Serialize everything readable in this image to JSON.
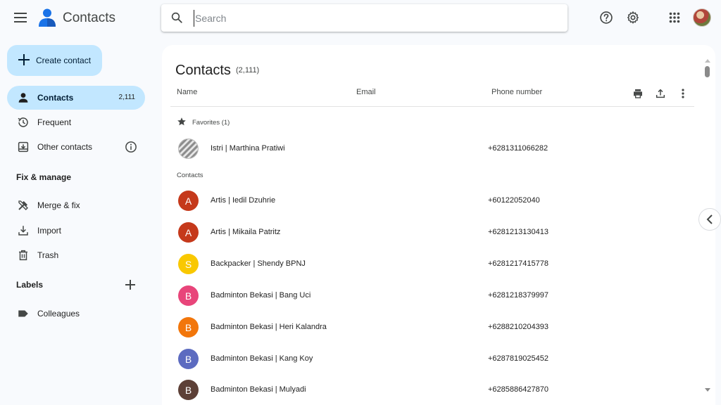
{
  "header": {
    "app_title": "Contacts",
    "search_placeholder": "Search",
    "icons": [
      "menu-icon",
      "contacts-logo-icon",
      "search-icon",
      "help-icon",
      "settings-icon",
      "apps-grid-icon",
      "account-avatar"
    ]
  },
  "sidebar": {
    "create_label": "Create contact",
    "items": [
      {
        "label": "Contacts",
        "count": "2,111",
        "icon": "person-icon",
        "active": true
      },
      {
        "label": "Frequent",
        "icon": "history-icon"
      },
      {
        "label": "Other contacts",
        "icon": "download-box-icon"
      }
    ],
    "fix_section": "Fix & manage",
    "fix_items": [
      {
        "label": "Merge & fix",
        "icon": "tools-icon"
      },
      {
        "label": "Import",
        "icon": "import-icon"
      },
      {
        "label": "Trash",
        "icon": "trash-icon"
      }
    ],
    "labels_section": "Labels",
    "label_items": [
      {
        "label": "Colleagues",
        "icon": "label-tag-icon"
      }
    ]
  },
  "main": {
    "title": "Contacts",
    "count": "(2,111)",
    "columns": {
      "name": "Name",
      "email": "Email",
      "phone": "Phone number"
    },
    "favorites_label": "Favorites (1)",
    "contacts_label": "Contacts",
    "favorites": [
      {
        "name": "Istri | Marthina Pratiwi",
        "phone": "+6281311066282"
      }
    ],
    "contacts": [
      {
        "initial": "A",
        "name": "Artis | Iedil Dzuhrie",
        "phone": "+60122052040",
        "color": "#c5391b"
      },
      {
        "initial": "A",
        "name": "Artis | Mikaila Patritz",
        "phone": "+6281213130413",
        "color": "#c5391b"
      },
      {
        "initial": "S",
        "name": "Backpacker | Shendy BPNJ",
        "phone": "+6281217415778",
        "color": "#f9c800"
      },
      {
        "initial": "B",
        "name": "Badminton Bekasi | Bang Uci",
        "phone": "+6281218379997",
        "color": "#e8457a"
      },
      {
        "initial": "B",
        "name": "Badminton Bekasi | Heri Kalandra",
        "phone": "+6288210204393",
        "color": "#f2760b"
      },
      {
        "initial": "B",
        "name": "Badminton Bekasi | Kang Koy",
        "phone": "+6287819025452",
        "color": "#5c6bc0"
      },
      {
        "initial": "B",
        "name": "Badminton Bekasi | Mulyadi",
        "phone": "+6285886427870",
        "color": "#5d4037"
      }
    ]
  }
}
